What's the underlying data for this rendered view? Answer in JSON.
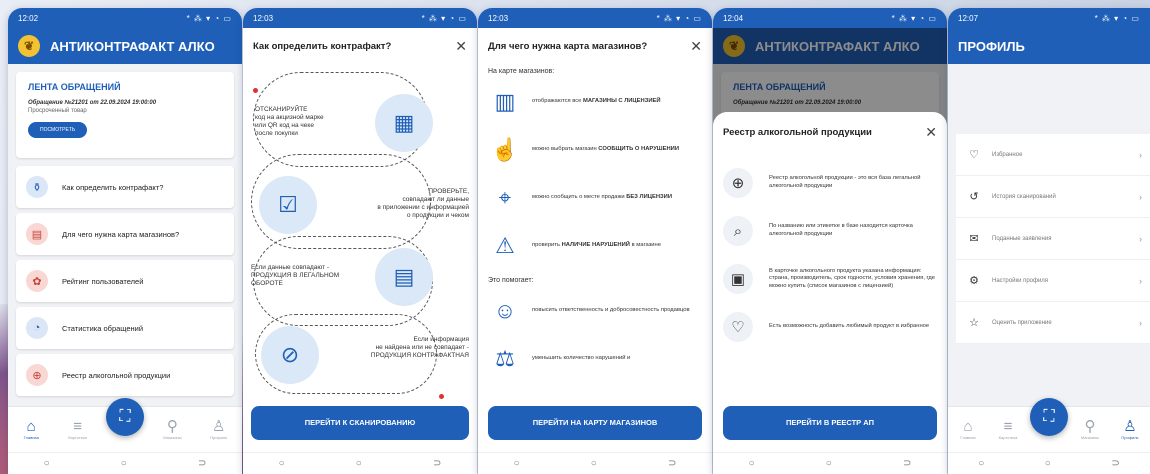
{
  "status_time": [
    "12:02",
    "12:03",
    "12:03",
    "12:04",
    "12:07"
  ],
  "status_icons": "* ⁂ ▾ ◔ ▭",
  "app_title": "АНТИКОНТРАФАКТ АЛКО",
  "screen1": {
    "feed_title": "ЛЕНТА ОБРАЩЕНИЙ",
    "feed_meta": "Обращение №21201 от 22.09.2024 19:00:00",
    "feed_desc": "Просроченный товар",
    "feed_button": "ПОСМОТРЕТЬ",
    "menu": [
      {
        "label": "Как определить контрафакт?",
        "icon": "bottles-icon"
      },
      {
        "label": "Для чего нужна карта магазинов?",
        "icon": "store-icon"
      },
      {
        "label": "Рейтинг пользователей",
        "icon": "wreath-icon"
      },
      {
        "label": "Статистика обращений",
        "icon": "pie-chart-icon"
      },
      {
        "label": "Реестр алкогольной продукции",
        "icon": "globe-icon"
      }
    ]
  },
  "tabs": [
    {
      "label": "Главная",
      "icon": "home-icon"
    },
    {
      "label": "Картотека",
      "icon": "layers-icon"
    },
    {
      "label": "",
      "icon": "scan-icon"
    },
    {
      "label": "Магазины",
      "icon": "map-pin-icon"
    },
    {
      "label": "Профиль",
      "icon": "user-icon"
    }
  ],
  "screen2": {
    "title": "Как определить контрафакт?",
    "steps": [
      "ОТСКАНИРУЙТЕ\nкод на акцизной марке\nили QR код на чеке\nпосле покупки",
      "ПРОВЕРЬТЕ,\nсовпадают ли данные\nв приложении с информацией\nо продукции и чеком",
      "Если данные совпадают -\nПРОДУКЦИЯ В ЛЕГАЛЬНОМ\nОБОРОТЕ",
      "Если информация\nне найдена или не совпадает -\nПРОДУКЦИЯ КОНТРАФАКТНАЯ"
    ],
    "button": "ПЕРЕЙТИ К СКАНИРОВАНИЮ"
  },
  "screen3": {
    "title": "Для чего нужна карта магазинов?",
    "section1": "На карте магазинов:",
    "items": [
      {
        "pre": "отображаются все ",
        "bold": "МАГАЗИНЫ С ЛИЦЕНЗИЕЙ",
        "post": ""
      },
      {
        "pre": "можно выбрать магазин ",
        "bold": "СООБЩИТЬ О НАРУШЕНИИ",
        "post": ""
      },
      {
        "pre": "можно сообщить о месте продажи ",
        "bold": "БЕЗ ЛИЦЕНЗИИ",
        "post": ""
      },
      {
        "pre": "проверить ",
        "bold": "НАЛИЧИЕ НАРУШЕНИЙ",
        "post": " в магазине"
      }
    ],
    "section2": "Это помогает:",
    "helps": [
      "повысить ответственность и добросовестность продавцов",
      "уменьшить количество нарушений и"
    ],
    "button": "ПЕРЕЙТИ НА КАРТУ МАГАЗИНОВ"
  },
  "screen4": {
    "feed_title": "ЛЕНТА ОБРАЩЕНИЙ",
    "feed_meta": "Обращение №21201 от 22.09.2024 19:00:00",
    "sheet_title": "Реестр алкогольной продукции",
    "rows": [
      "Реестр алкогольной продукции - это вся база легальной алкогольной продукции",
      "По названию или этикетке в базе находится карточка алкогольной продукции",
      "В карточке алкогольного продукта указана информация: страна, производитель, срок годности, условия хранения, где можно купить (список магазинов с лицензией)",
      "Есть возможность добавить любимый продукт в избранное"
    ],
    "button": "ПЕРЕЙТИ В РЕЕСТР АП"
  },
  "screen5": {
    "title": "ПРОФИЛЬ",
    "items": [
      {
        "label": "Избранное",
        "icon": "heart-icon"
      },
      {
        "label": "История сканирований",
        "icon": "history-icon"
      },
      {
        "label": "Поданные заявления",
        "icon": "envelope-icon"
      },
      {
        "label": "Настройки профиля",
        "icon": "settings-icon"
      },
      {
        "label": "Оценить приложение",
        "icon": "star-icon"
      }
    ]
  },
  "nav": [
    "○",
    "○",
    "⊃"
  ]
}
